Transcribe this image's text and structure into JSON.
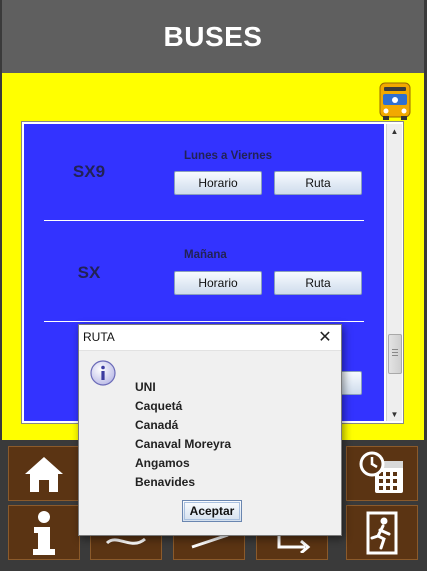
{
  "header": {
    "title": "BUSES"
  },
  "routes": [
    {
      "name": "SX9",
      "days": "Lunes a Viernes",
      "schedule_label": "Horario",
      "route_label": "Ruta"
    },
    {
      "name": "SX",
      "days": "Mañana",
      "schedule_label": "Horario",
      "route_label": "Ruta"
    }
  ],
  "dialog": {
    "title": "RUTA",
    "stops": [
      "UNI",
      "Caquetá",
      "Canadá",
      "Canaval Moreyra",
      "Angamos",
      "Benavides"
    ],
    "ok_label": "Aceptar"
  },
  "nav": {
    "icons": [
      "home-icon",
      "info-icon",
      "route-icon",
      "map-icon",
      "direction-icon",
      "calendar-clock-icon",
      "exit-icon"
    ]
  },
  "colors": {
    "header_bg": "#5f5f5f",
    "panel_bg": "#ffff00",
    "list_bg": "#3333ff",
    "tile_bg": "#5b3413"
  }
}
